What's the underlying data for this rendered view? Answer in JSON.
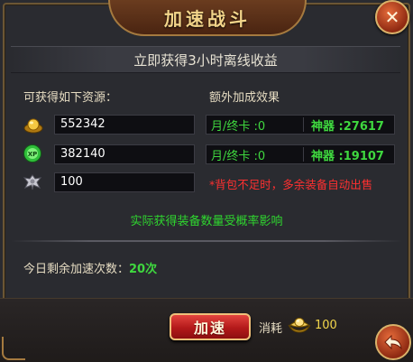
{
  "window": {
    "title": "加速战斗"
  },
  "banner": {
    "text": "立即获得3小时离线收益"
  },
  "resources": {
    "header": "可获得如下资源：",
    "rows": [
      {
        "icon": "gold-ingot-icon",
        "value": "552342"
      },
      {
        "icon": "exp-orb-icon",
        "value": "382140"
      },
      {
        "icon": "equipment-icon",
        "value": "100"
      }
    ]
  },
  "bonus": {
    "header": "额外加成效果",
    "rows": [
      {
        "card": "月/终卡 :0",
        "artifact": "神器 :27617"
      },
      {
        "card": "月/终卡 :0",
        "artifact": "神器 :19107"
      }
    ],
    "warning": "*背包不足时，多余装备自动出售"
  },
  "note": "实际获得装备数量受概率影响",
  "remaining": {
    "label": "今日剩余加速次数：",
    "count": "20次"
  },
  "action": {
    "button_label": "加速",
    "cost_label": "消耗",
    "cost_icon": "yuanbao-icon",
    "cost_value": "100"
  },
  "colors": {
    "accent_green": "#3fd83f",
    "warning_red": "#ff3030",
    "gold_text": "#f3d58a"
  }
}
